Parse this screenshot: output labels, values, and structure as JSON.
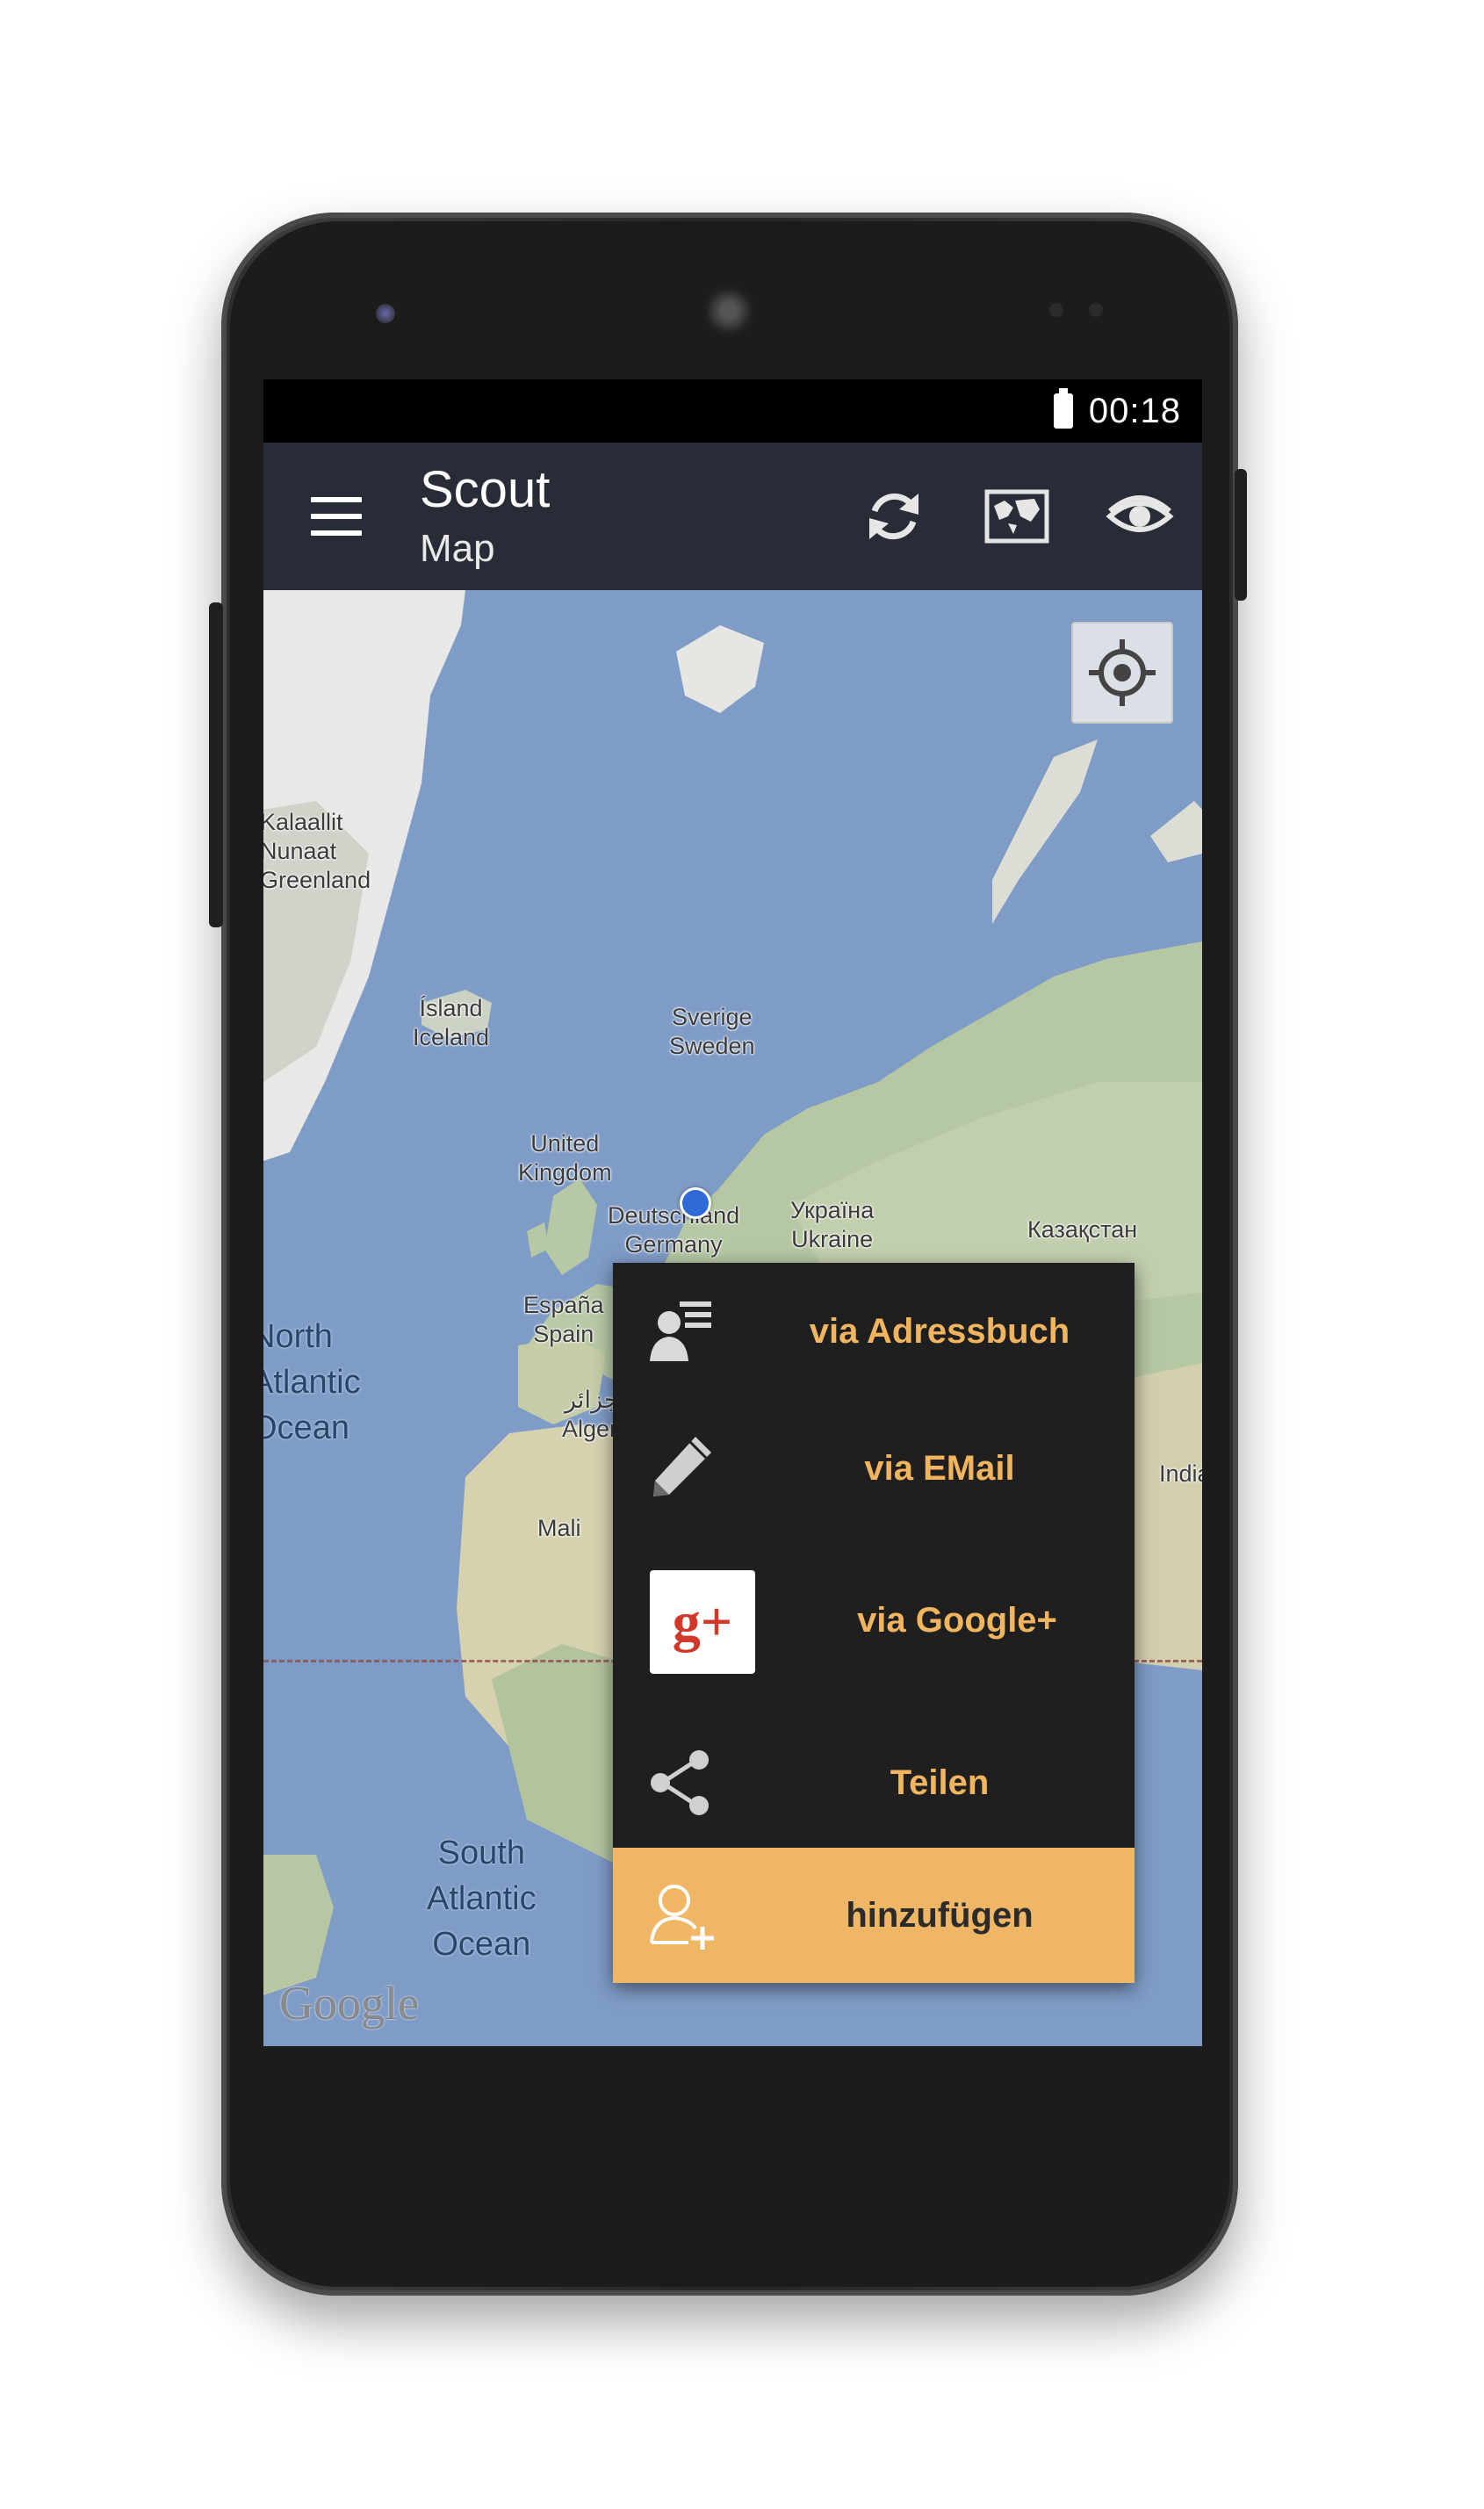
{
  "status_bar": {
    "time": "00:18",
    "battery_icon": "battery-full-icon"
  },
  "action_bar": {
    "title": "Scout",
    "subtitle": "Map",
    "menu_icon": "hamburger-menu-icon",
    "actions": [
      "refresh-icon",
      "map-layers-icon",
      "eye-icon"
    ]
  },
  "map": {
    "labels": {
      "greenland": "Kalaallit\nNunaat\nGreenland",
      "iceland": "Ísland\nIceland",
      "sweden": "Sverige\nSweden",
      "uk": "United\nKingdom",
      "germany": "Deutschland\nGermany",
      "ukraine": "Україна\nUkraine",
      "kazakhstan": "Казақстан",
      "spain": "España\nSpain",
      "algeria": "الجزائر\nAlgeria",
      "mali": "Mali",
      "india": "India",
      "north_atlantic": "North\nAtlantic\nOcean",
      "south_atlantic": "South\nAtlantic\nOcean"
    },
    "attribution": "Google",
    "locate_icon": "my-location-icon"
  },
  "share_menu": {
    "items": [
      {
        "label": "via Adressbuch",
        "icon": "contacts-icon"
      },
      {
        "label": "via EMail",
        "icon": "pencil-icon"
      },
      {
        "label": "via Google+",
        "icon": "google-plus-icon"
      },
      {
        "label": "Teilen",
        "icon": "share-icon"
      }
    ],
    "add": {
      "label": "hinzufügen",
      "icon": "add-person-icon"
    }
  },
  "colors": {
    "accent": "#efb765",
    "menu_text": "#f0b55e",
    "ocean": "#7f9cc7",
    "action_bar": "#20242c"
  }
}
